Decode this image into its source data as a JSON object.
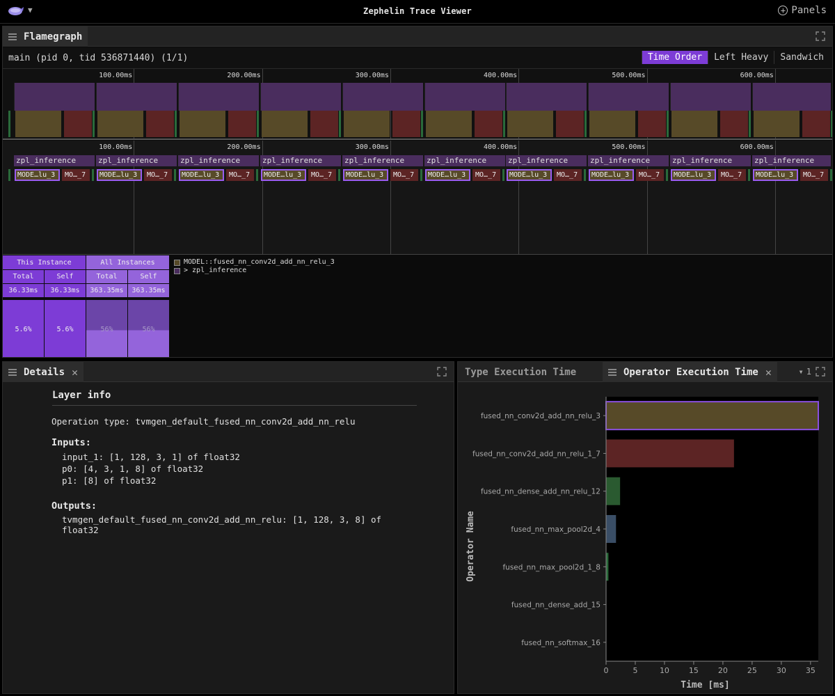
{
  "app": {
    "title": "Zephelin Trace Viewer",
    "panels_label": "Panels"
  },
  "flamegraph": {
    "tab_label": "Flamegraph",
    "process_label": "main (pid 0, tid 536871440) (1/1)",
    "view_modes": [
      "Time Order",
      "Left Heavy",
      "Sandwich"
    ],
    "active_view": "Time Order",
    "ticks": [
      "100.00ms",
      "200.00ms",
      "300.00ms",
      "400.00ms",
      "500.00ms",
      "600.00ms"
    ],
    "frame_top_label": "zpl_inference",
    "frame_a_label": "MODE…lu_3",
    "frame_b_label": "MO…_7",
    "stats": {
      "this_instance": "This Instance",
      "all_instances": "All Instances",
      "total": "Total",
      "self": "Self",
      "this_total": "36.33ms",
      "this_self": "36.33ms",
      "all_total": "363.35ms",
      "all_self": "363.35ms",
      "this_total_pct": "5.6%",
      "this_self_pct": "5.6%",
      "all_total_pct": "56%",
      "all_self_pct": "56%"
    },
    "legend": [
      {
        "label": "MODEL::fused_nn_conv2d_add_nn_relu_3",
        "color": "#574a28"
      },
      {
        "label": "> zpl_inference",
        "color": "#4a2d5e"
      }
    ]
  },
  "details": {
    "tab_label": "Details",
    "layer_title": "Layer info",
    "operation_type": "Operation type: tvmgen_default_fused_nn_conv2d_add_nn_relu",
    "inputs_label": "Inputs:",
    "inputs": [
      "input_1: [1, 128, 3, 1] of float32",
      "p0: [4, 3, 1, 8] of float32",
      "p1: [8] of float32"
    ],
    "outputs_label": "Outputs:",
    "outputs": [
      "tvmgen_default_fused_nn_conv2d_add_nn_relu: [1, 128, 3, 8] of float32"
    ]
  },
  "operator_panel": {
    "tab_inactive": "Type Execution Time",
    "tab_active": "Operator Execution Time",
    "filter_count": "1"
  },
  "chart_data": {
    "type": "bar",
    "orientation": "horizontal",
    "categories": [
      "fused_nn_conv2d_add_nn_relu_3",
      "fused_nn_conv2d_add_nn_relu_1_7",
      "fused_nn_dense_add_nn_relu_12",
      "fused_nn_max_pool2d_4",
      "fused_nn_max_pool2d_1_8",
      "fused_nn_dense_add_15",
      "fused_nn_softmax_16"
    ],
    "values": [
      36.33,
      21.9,
      2.4,
      1.7,
      0.4,
      0.05,
      0.03
    ],
    "colors": [
      "#574a28",
      "#5c2424",
      "#2a5a30",
      "#3a4e66",
      "#2a6a3a",
      "#444444",
      "#444444"
    ],
    "highlighted": "fused_nn_conv2d_add_nn_relu_3",
    "highlight_color": "#8a4fe0",
    "xlabel": "Time [ms]",
    "ylabel": "Operator Name",
    "xticks": [
      0,
      5,
      10,
      15,
      20,
      25,
      30,
      35
    ],
    "xlim": [
      0,
      36.33
    ],
    "grid": false
  }
}
